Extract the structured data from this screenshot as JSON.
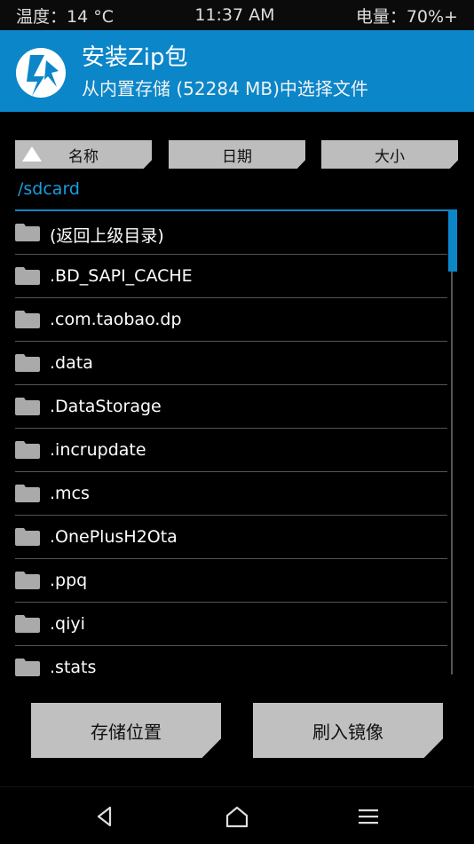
{
  "status": {
    "temperature": "温度：14 °C",
    "time": "11:37 AM",
    "battery": "电量：70%+"
  },
  "header": {
    "title": "安装Zip包",
    "subtitle": "从内置存储 (52284 MB)中选择文件"
  },
  "sort": {
    "name": "名称",
    "date": "日期",
    "size": "大小"
  },
  "path": "/sdcard",
  "files": [
    "(返回上级目录)",
    ".BD_SAPI_CACHE",
    ".com.taobao.dp",
    ".data",
    ".DataStorage",
    ".incrupdate",
    ".mcs",
    ".OnePlusH2Ota",
    ".ppq",
    ".qiyi",
    ".stats"
  ],
  "actions": {
    "storage": "存储位置",
    "flash_image": "刷入镜像"
  },
  "colors": {
    "accent": "#0b86c9",
    "button": "#c0c0c0"
  }
}
